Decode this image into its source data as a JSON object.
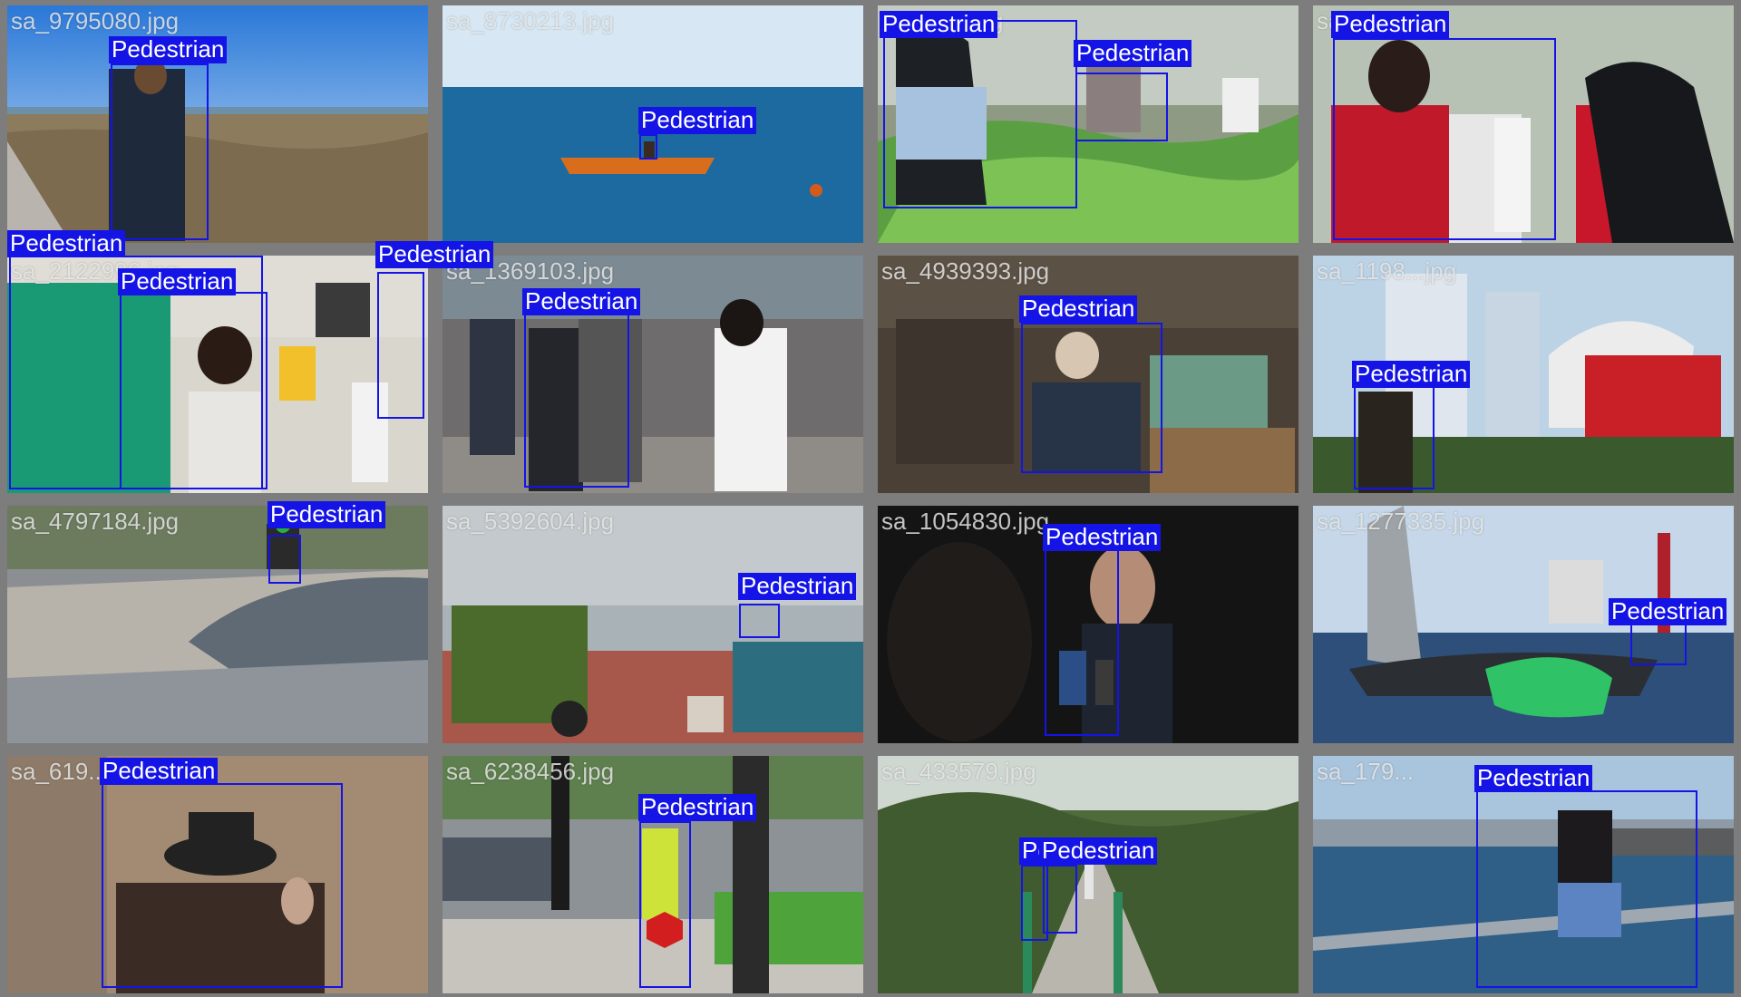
{
  "detection_label": "Pedestrian",
  "colors": {
    "box": "#1414e6",
    "label_text": "#ffffff",
    "grid_bg": "#7d7d7d"
  },
  "tiles": [
    {
      "filename": "sa_9795080.jpg",
      "scene": "coast"
    },
    {
      "filename": "sa_8730213.jpg",
      "scene": "sea"
    },
    {
      "filename": "sa_7...9.jpg",
      "scene": "greenhouse"
    },
    {
      "filename": "sa_...jpg",
      "scene": "clinic"
    },
    {
      "filename": "sa_2122996.jpg",
      "scene": "vaccination"
    },
    {
      "filename": "sa_1369103.jpg",
      "scene": "street"
    },
    {
      "filename": "sa_4939393.jpg",
      "scene": "workshop"
    },
    {
      "filename": "sa_1198...jpg",
      "scene": "stage"
    },
    {
      "filename": "sa_4797184.jpg",
      "scene": "skatepark"
    },
    {
      "filename": "sa_5392604.jpg",
      "scene": "market"
    },
    {
      "filename": "sa_1054830.jpg",
      "scene": "interview"
    },
    {
      "filename": "sa_1277335.jpg",
      "scene": "sailboat"
    },
    {
      "filename": "sa_619...",
      "scene": "wall"
    },
    {
      "filename": "sa_6238456.jpg",
      "scene": "crosswalk"
    },
    {
      "filename": "sa_433579.jpg",
      "scene": "forest"
    },
    {
      "filename": "sa_179...",
      "scene": "bosphorus"
    }
  ]
}
